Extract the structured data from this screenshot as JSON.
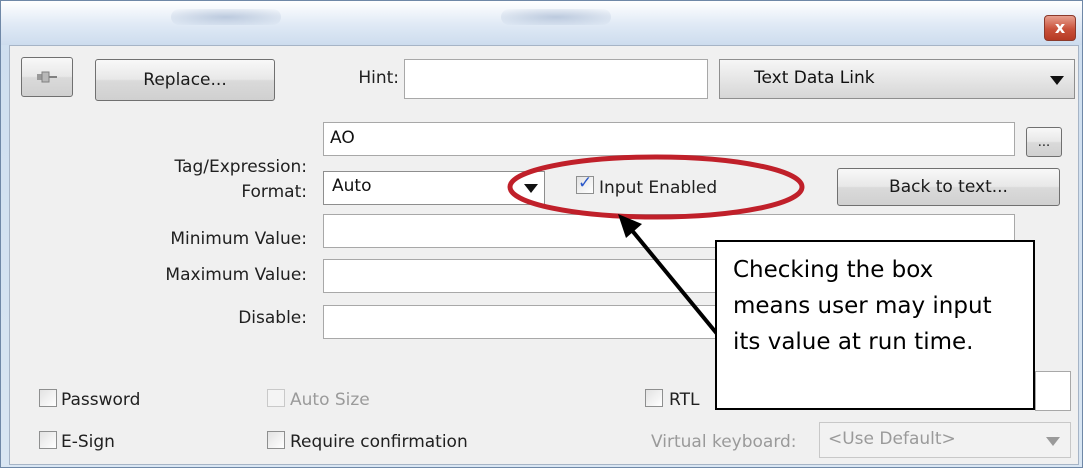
{
  "window": {
    "close_glyph": "x"
  },
  "toolbar": {
    "pin_icon": "pin-icon",
    "replace_label": "Replace...",
    "hint_label": "Hint:",
    "hint_value": "",
    "link_type_selected": "Text Data Link"
  },
  "form": {
    "tag_label": "Tag/Expression:",
    "tag_value": "AO",
    "browse_label": "...",
    "format_label": "Format:",
    "format_selected": "Auto",
    "input_enabled_label": "Input Enabled",
    "input_enabled_checked": true,
    "back_to_text_label": "Back to text...",
    "min_label": "Minimum Value:",
    "min_value": "",
    "max_label": "Maximum Value:",
    "max_value": "",
    "disable_label": "Disable:",
    "disable_value": ""
  },
  "options": {
    "password_label": "Password",
    "auto_size_label": "Auto Size",
    "rtl_label": "RTL",
    "esign_label": "E-Sign",
    "require_confirmation_label": "Require confirmation",
    "virtual_keyboard_label": "Virtual keyboard:",
    "virtual_keyboard_selected": "<Use Default>"
  },
  "annotation": {
    "callout_text": "Checking the box means user may input its value at run time.",
    "highlight_color": "#c0202a"
  }
}
